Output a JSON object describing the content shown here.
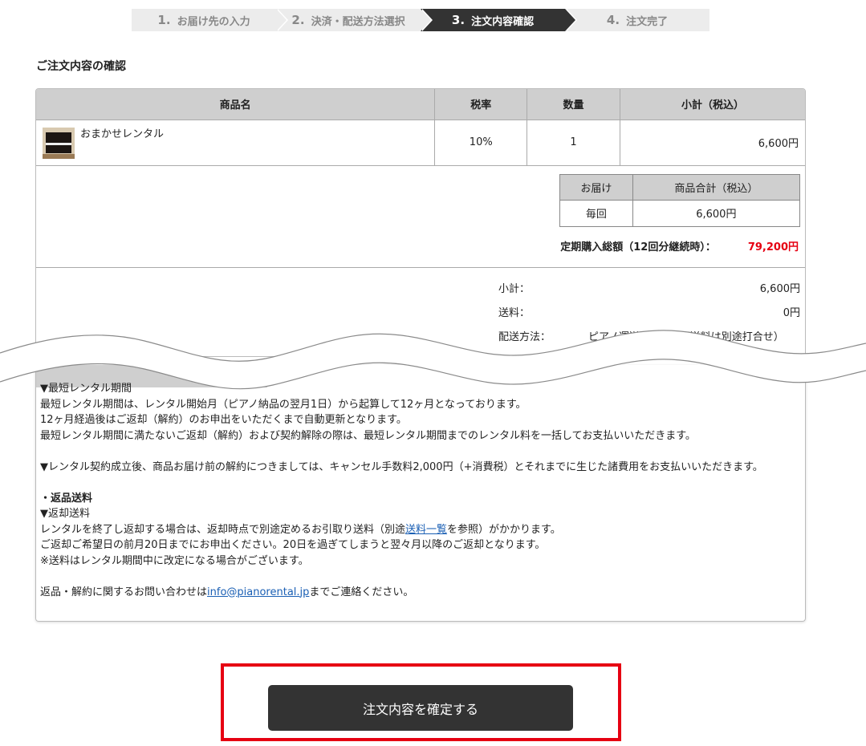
{
  "steps": [
    {
      "num": "1.",
      "label": "お届け先の入力"
    },
    {
      "num": "2.",
      "label": "決済・配送方法選択"
    },
    {
      "num": "3.",
      "label": "注文内容確認"
    },
    {
      "num": "4.",
      "label": "注文完了"
    }
  ],
  "section_title": "ご注文内容の確認",
  "table": {
    "headers": [
      "商品名",
      "税率",
      "数量",
      "小計（税込）"
    ],
    "row": {
      "name": "おまかせレンタル",
      "tax": "10%",
      "qty": "1",
      "subtotal": "6,600円"
    }
  },
  "delivery": {
    "headers": [
      "お届け",
      "商品合計（税込）"
    ],
    "row": [
      "毎回",
      "6,600円"
    ],
    "total_label": "定期購入総額（12回分継続時）：",
    "total_amount": "79,200円"
  },
  "sums": {
    "subtotal_label": "小計：",
    "subtotal_value": "6,600円",
    "shipping_label": "送料：",
    "shipping_value": "0円",
    "method_label": "配送方法：",
    "method_value": "ピアノ運送会社（※配送料は別途打合せ）"
  },
  "terms": {
    "l1": "▼最短レンタル期間",
    "l2": "最短レンタル期間は、レンタル開始月（ピアノ納品の翌月1日）から起算して12ヶ月となっております。",
    "l3": "12ヶ月経過後はご返却（解約）のお申出をいただくまで自動更新となります。",
    "l4": "最短レンタル期間に満たないご返却（解約）および契約解除の際は、最短レンタル期間までのレンタル料を一括してお支払いいただきます。",
    "l5": "▼レンタル契約成立後、商品お届け前の解約につきましては、キャンセル手数料2,000円（+消費税）とそれまでに生じた諸費用をお支払いいただきます。",
    "l6": "・返品送料",
    "l7": "▼返却送料",
    "l8a": "レンタルを終了し返却する場合は、返却時点で別途定めるお引取り送料（別途",
    "l8link": "送料一覧",
    "l8b": "を参照）がかかります。",
    "l9": "ご返却ご希望日の前月20日までにお申出ください。20日を過ぎてしまうと翌々月以降のご返却となります。",
    "l10": "※送料はレンタル期間中に改定になる場合がございます。",
    "l11a": "返品・解約に関するお問い合わせは",
    "l11link": "info@pianorental.jp",
    "l11b": "までご連絡ください。"
  },
  "confirm_button": "注文内容を確定する",
  "colors": {
    "accent_red": "#e60012",
    "dark": "#333333",
    "header_gray": "#cfcfcf"
  }
}
